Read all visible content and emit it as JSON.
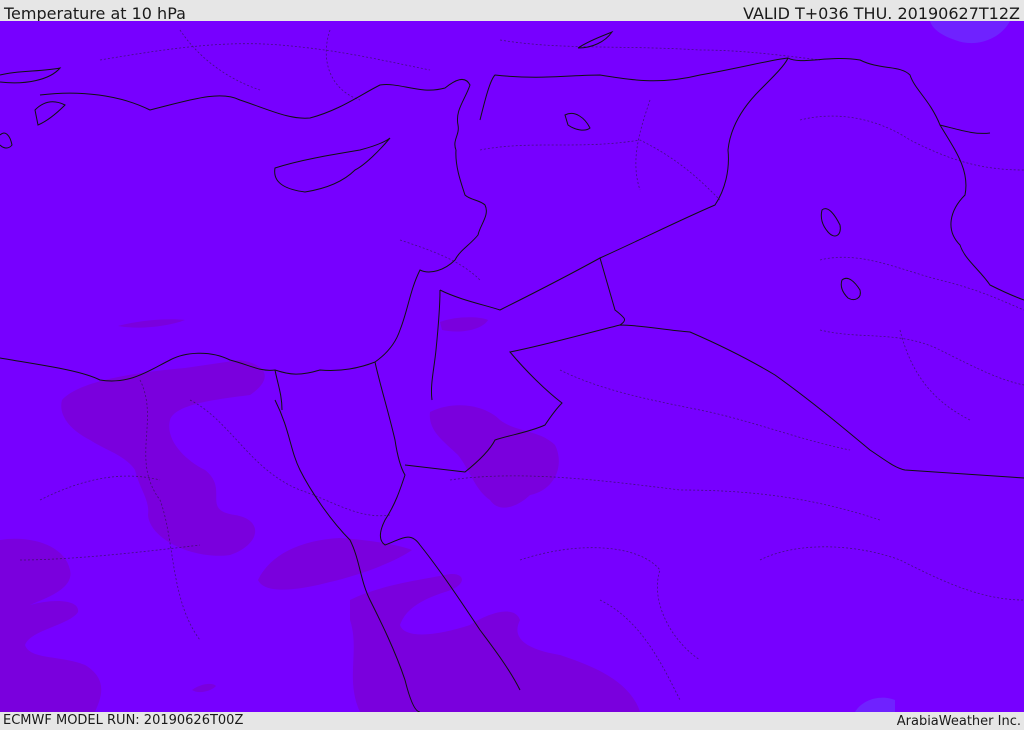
{
  "header": {
    "title": "Temperature at 10 hPa",
    "valid": "VALID T+036 THU. 20190627T12Z"
  },
  "footer": {
    "model_run": "ECMWF MODEL RUN: 20190626T00Z",
    "credit": "ArabiaWeather Inc."
  },
  "colors": {
    "base_field": "#7700ff",
    "cooler_field": "#7a00dd",
    "coast": "#111111",
    "background": "#e6e6e6"
  }
}
